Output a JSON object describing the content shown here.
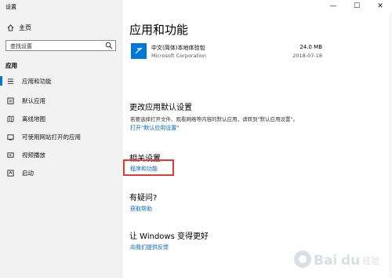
{
  "window": {
    "title": "设置",
    "controls": {
      "minimize": "—",
      "maximize": "☐",
      "close": "✕"
    }
  },
  "sidebar": {
    "home_label": "主页",
    "search_placeholder": "查找设置",
    "section_label": "应用",
    "items": [
      {
        "label": "应用和功能",
        "icon": "apps-list-icon",
        "active": true
      },
      {
        "label": "默认应用",
        "icon": "default-apps-icon",
        "active": false
      },
      {
        "label": "离线地图",
        "icon": "map-icon",
        "active": false
      },
      {
        "label": "可使用网站打开的应用",
        "icon": "web-apps-icon",
        "active": false
      },
      {
        "label": "视频播放",
        "icon": "video-icon",
        "active": false
      },
      {
        "label": "启动",
        "icon": "startup-icon",
        "active": false
      }
    ]
  },
  "main": {
    "title": "应用和功能",
    "app": {
      "name": "中文(简体)本地体验包",
      "publisher": "Microsoft Corporation",
      "size": "24.0 MB",
      "date": "2018-07-18"
    },
    "default_settings": {
      "heading": "更改应用默认设置",
      "description": "若要选择打开文件、观看网络等内容的默认应用，请转到\"默认应用设置\"。",
      "link": "打开\"默认应用设置\""
    },
    "related": {
      "heading": "相关设置",
      "link": "程序和功能"
    },
    "help": {
      "heading": "有疑问?",
      "link": "获取帮助"
    },
    "improve": {
      "heading": "让 Windows 变得更好",
      "link": "向我们提供反馈"
    }
  },
  "colors": {
    "accent": "#0078d7",
    "link": "#0067b8",
    "highlight_box": "#e53935",
    "sidebar_bg": "#f2f2f2"
  },
  "watermark": {
    "text": "Baidu 经验"
  }
}
